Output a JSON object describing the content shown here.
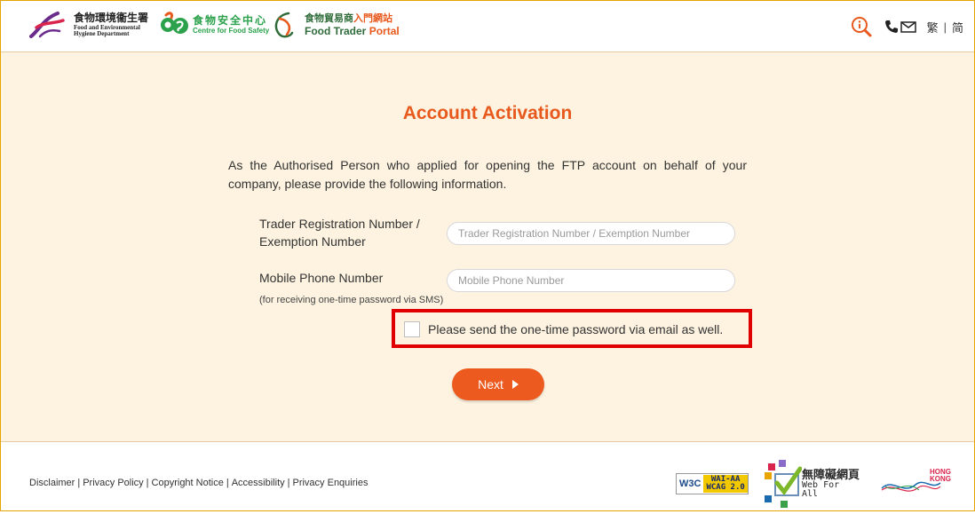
{
  "header": {
    "fehd_logo": {
      "zh": "食物環境衞生署",
      "en_line1": "Food and Environmental",
      "en_line2": "Hygiene Department"
    },
    "cfs_logo": {
      "zh": "食物安全中心",
      "en": "Centre for Food Safety"
    },
    "ftp_logo": {
      "zh_main": "食物貿易商",
      "zh_accent": "入門網站",
      "en_main": "Food Trader",
      "en_accent": "Portal"
    },
    "icons": [
      "info-search-icon",
      "phone-icon",
      "mail-icon"
    ],
    "lang_trad": "繁",
    "lang_separator": "|",
    "lang_simp": "简"
  },
  "main": {
    "title": "Account Activation",
    "intro": "As the Authorised Person who applied for opening the FTP account on behalf of your company, please provide the following information.",
    "trader_label_line1": "Trader Registration Number /",
    "trader_label_line2": "Exemption Number",
    "trader_placeholder": "Trader Registration Number / Exemption Number",
    "trader_value": "",
    "mobile_label": "Mobile Phone Number",
    "mobile_sublabel": "(for receiving one-time password via SMS)",
    "mobile_placeholder": "Mobile Phone Number",
    "mobile_value": "",
    "email_checkbox_label": "Please send the one-time password via email as well.",
    "email_checkbox_checked": false,
    "next_label": "Next"
  },
  "footer": {
    "links": [
      "Disclaimer",
      "Privacy Policy",
      "Copyright Notice",
      "Accessibility",
      "Privacy Enquiries"
    ],
    "w3c_badge": {
      "w3c": "W3C",
      "line1": "WAI-AA",
      "line2": "WCAG 2.0"
    },
    "wfa_badge": {
      "zh": "無障礙網頁",
      "en": "Web For All"
    },
    "hk_brand": {
      "line1": "HONG",
      "line2": "KONG"
    }
  },
  "colors": {
    "accent": "#ec5a20",
    "title": "#e8591d",
    "main_bg": "#fdf3e0",
    "highlight": "#e00000",
    "cfs_green": "#2aa14a"
  }
}
